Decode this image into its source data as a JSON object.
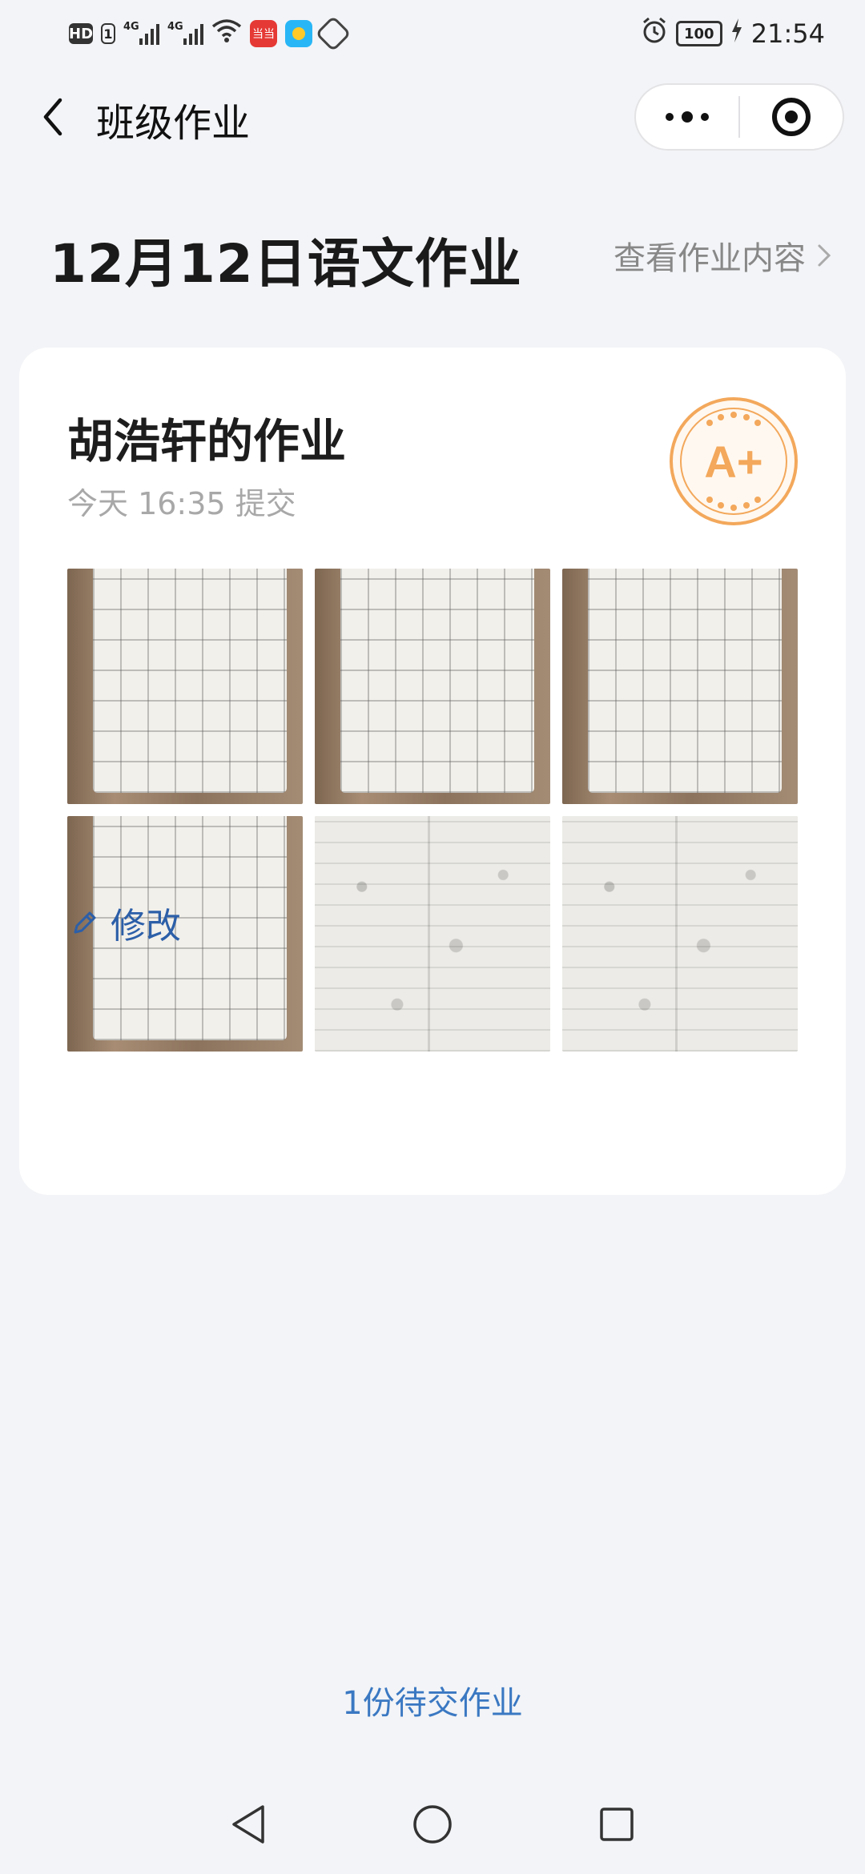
{
  "status_bar": {
    "left_badges": [
      "HD",
      "1"
    ],
    "signal_labels": [
      "4G",
      "4G"
    ],
    "app_badge_text": "当当",
    "battery": "100",
    "time": "21:54"
  },
  "nav": {
    "title": "班级作业"
  },
  "homework": {
    "title": "12月12日语文作业",
    "view_link": "查看作业内容"
  },
  "submission": {
    "student_title": "胡浩轩的作业",
    "submitted": "今天 16:35 提交",
    "grade": "A+",
    "photos": [
      {
        "name": "photo-1",
        "style": "notebook"
      },
      {
        "name": "photo-2",
        "style": "notebook"
      },
      {
        "name": "photo-3",
        "style": "notebook"
      },
      {
        "name": "photo-4",
        "style": "notebook"
      },
      {
        "name": "photo-5",
        "style": "worksheet"
      },
      {
        "name": "photo-6",
        "style": "worksheet"
      }
    ],
    "edit_label": "修改"
  },
  "footer": {
    "pending": "1份待交作业"
  },
  "colors": {
    "accent_blue": "#2c5fa8",
    "link_blue": "#3a78c2",
    "grade_orange": "#f3a85b",
    "background": "#f3f4f7"
  }
}
